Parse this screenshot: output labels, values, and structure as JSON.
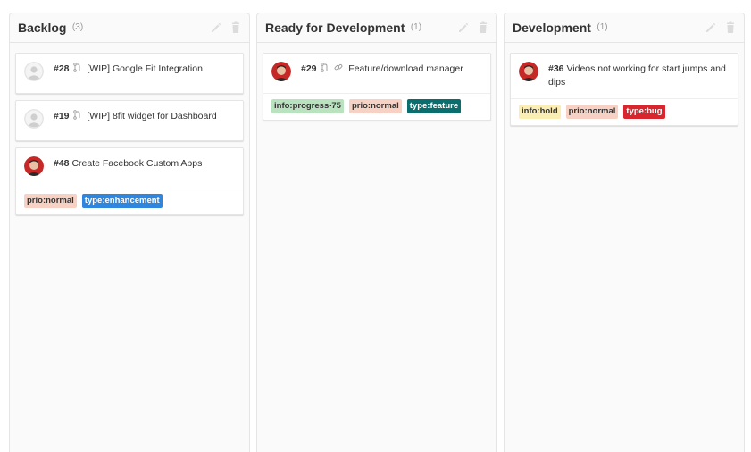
{
  "board": {
    "columns": [
      {
        "title": "Backlog",
        "count": "(3)",
        "cards": [
          {
            "number": "#28",
            "title": "[WIP] Google Fit Integration",
            "avatar": "default",
            "icons": [
              "merge-request-icon"
            ],
            "labels": []
          },
          {
            "number": "#19",
            "title": "[WIP] 8fit widget for Dashboard",
            "avatar": "default",
            "icons": [
              "merge-request-icon"
            ],
            "labels": []
          },
          {
            "number": "#48",
            "title": "Create Facebook Custom Apps",
            "avatar": "user",
            "icons": [],
            "labels": [
              {
                "text": "prio:normal",
                "bg": "#f7d2c4",
                "fg": "#333333"
              },
              {
                "text": "type:enhancement",
                "bg": "#2e86de",
                "fg": "#ffffff"
              }
            ]
          }
        ]
      },
      {
        "title": "Ready for Development",
        "count": "(1)",
        "cards": [
          {
            "number": "#29",
            "title": "Feature/download manager",
            "avatar": "user",
            "icons": [
              "merge-request-icon",
              "link-icon"
            ],
            "labels": [
              {
                "text": "info:progress-75",
                "bg": "#b9e3be",
                "fg": "#333333"
              },
              {
                "text": "prio:normal",
                "bg": "#f7d2c4",
                "fg": "#333333"
              },
              {
                "text": "type:feature",
                "bg": "#0b6e6e",
                "fg": "#ffffff"
              }
            ]
          }
        ]
      },
      {
        "title": "Development",
        "count": "(1)",
        "cards": [
          {
            "number": "#36",
            "title": "Videos not working for start jumps and dips",
            "avatar": "user",
            "icons": [],
            "labels": [
              {
                "text": "info:hold",
                "bg": "#fbeeb5",
                "fg": "#333333"
              },
              {
                "text": "prio:normal",
                "bg": "#f7d2c4",
                "fg": "#333333"
              },
              {
                "text": "type:bug",
                "bg": "#d9262e",
                "fg": "#ffffff"
              }
            ]
          }
        ]
      }
    ]
  }
}
